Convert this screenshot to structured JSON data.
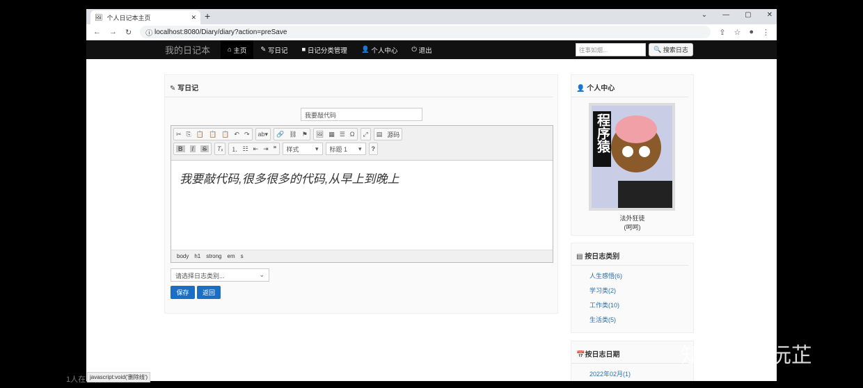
{
  "browser": {
    "tab_title": "个人日记本主页",
    "url": "localhost:8080/Diary/diary?action=preSave"
  },
  "navbar": {
    "brand": "我的日记本",
    "items": [
      "主页",
      "写日记",
      "日记分类管理",
      "个人中心",
      "退出"
    ],
    "search_placeholder": "往事如烟...",
    "search_button": "搜索日志"
  },
  "editor_panel": {
    "heading": "写日记",
    "title_value": "我要敲代码",
    "toolbar": {
      "source": "源码",
      "style": "样式",
      "format": "标题 1",
      "help": "?"
    },
    "content": "我要敲代码,很多很多的代码,从早上到晚上",
    "path": [
      "body",
      "h1",
      "strong",
      "em",
      "s"
    ],
    "category_placeholder": "请选择日志类别...",
    "save": "保存",
    "back": "返回"
  },
  "profile": {
    "heading": "个人中心",
    "name": "法外狂徒",
    "signature": "(呵呵)",
    "avatar_text": "程序猿"
  },
  "categories": {
    "heading": "按日志类别",
    "items": [
      "人生感悟(6)",
      "学习类(2)",
      "工作类(10)",
      "生活类(5)"
    ]
  },
  "dates": {
    "heading": "按日志日期",
    "items": [
      "2022年02月(1)"
    ]
  },
  "status_bar": "javascript:void('删除线')",
  "viewers": "1人在观看",
  "watermark": "知乎 @小沅芷"
}
